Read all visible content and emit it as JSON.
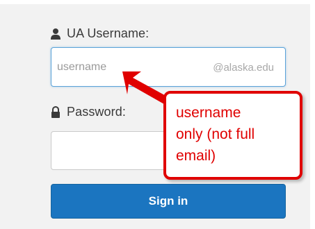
{
  "form": {
    "username_label": "UA Username:",
    "username_placeholder": "username",
    "username_suffix": "@alaska.edu",
    "password_label": "Password:",
    "password_value": "",
    "signin_label": "Sign in"
  },
  "annotation": {
    "lines": [
      "username",
      "only (not full",
      "email)"
    ],
    "color": "#e00000"
  },
  "icons": {
    "username": "user-icon",
    "password": "lock-icon"
  },
  "colors": {
    "button": "#1b75c0",
    "focus_border": "#5aa2d8"
  }
}
